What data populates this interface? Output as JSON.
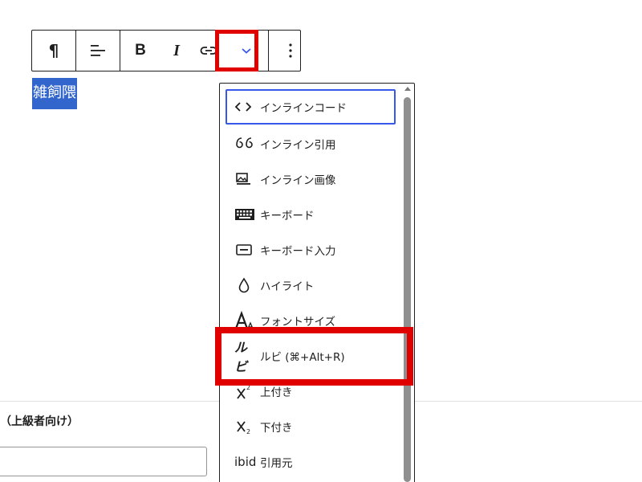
{
  "toolbar": {
    "buttons": [
      {
        "name": "paragraph",
        "glyph": "¶"
      },
      {
        "name": "align",
        "glyph": "align-icon"
      },
      {
        "name": "bold",
        "glyph": "B"
      },
      {
        "name": "italic",
        "glyph": "I"
      },
      {
        "name": "link",
        "glyph": "link-icon"
      },
      {
        "name": "more-rich-text",
        "glyph": "chevron-down-icon"
      },
      {
        "name": "options",
        "glyph": "⋮"
      }
    ],
    "bold_label": "B",
    "italic_label": "I",
    "paragraph_label": "¶",
    "options_label": "⋮"
  },
  "editor": {
    "selected_text": "雑飼隈"
  },
  "dropdown": {
    "items": [
      {
        "label": "インラインコード",
        "icon": "code-icon"
      },
      {
        "label": "インライン引用",
        "icon": "quote-icon"
      },
      {
        "label": "インライン画像",
        "icon": "image-icon"
      },
      {
        "label": "キーボード",
        "icon": "keyboard-icon"
      },
      {
        "label": "キーボード入力",
        "icon": "keyboard-input-icon"
      },
      {
        "label": "ハイライト",
        "icon": "highlight-drop-icon"
      },
      {
        "label": "フォントサイズ",
        "icon": "font-size-icon"
      },
      {
        "label": "ルビ (⌘+Alt+R)",
        "icon": "ruby-icon"
      },
      {
        "label": "上付き",
        "icon": "superscript-icon"
      },
      {
        "label": "下付き",
        "icon": "subscript-icon"
      },
      {
        "label": "引用元",
        "icon": "ibid-icon"
      }
    ],
    "icon_text": {
      "ruby": "ルビ",
      "ibid": "ibid"
    }
  },
  "panel": {
    "heading": "（上級者向け）"
  },
  "colors": {
    "highlight_red": "#e00000",
    "focus_blue": "#3858e9",
    "selection_blue": "#3366cc",
    "chevron_blue": "#3858e9"
  }
}
